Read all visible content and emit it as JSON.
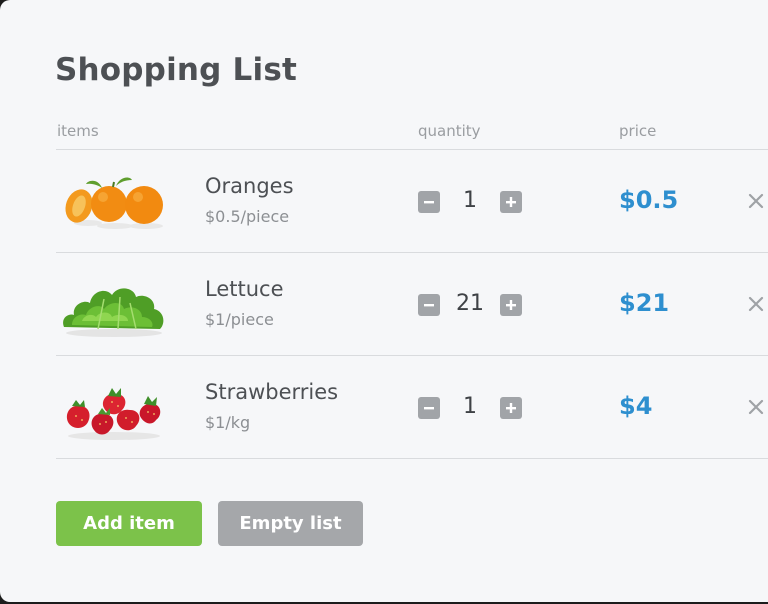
{
  "title": "Shopping List",
  "columns": {
    "items": "items",
    "quantity": "quantity",
    "price": "price"
  },
  "items": [
    {
      "name": "Oranges",
      "unit_price": "$0.5/piece",
      "quantity": "1",
      "total": "$0.5",
      "image": "oranges-image"
    },
    {
      "name": "Lettuce",
      "unit_price": "$1/piece",
      "quantity": "21",
      "total": "$21",
      "image": "lettuce-image"
    },
    {
      "name": "Strawberries",
      "unit_price": "$1/kg",
      "quantity": "1",
      "total": "$4",
      "image": "strawberries-image"
    }
  ],
  "buttons": {
    "add": "Add item",
    "empty": "Empty list"
  },
  "colors": {
    "accent_price": "#2e8fcf",
    "add_button": "#7cc24a",
    "empty_button": "#a5a7aa",
    "qty_button": "#a1a4a8"
  }
}
